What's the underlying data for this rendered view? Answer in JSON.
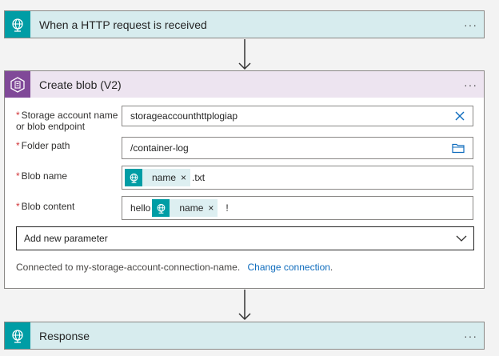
{
  "trigger": {
    "title": "When a HTTP request is received",
    "more": "···"
  },
  "action": {
    "title": "Create blob (V2)",
    "more": "···",
    "fields": {
      "storage_account": {
        "label_line1": "Storage account name",
        "label_line2": "or blob endpoint",
        "value": "storageaccounthttplogiap",
        "required": "*"
      },
      "folder_path": {
        "label": "Folder path",
        "value": "/container-log",
        "required": "*"
      },
      "blob_name": {
        "label": "Blob name",
        "token": "name",
        "suffix": ".txt",
        "required": "*"
      },
      "blob_content": {
        "label": "Blob content",
        "prefix": "hello",
        "token": "name",
        "suffix": "!",
        "required": "*"
      }
    },
    "add_parameter": "Add new parameter",
    "connection_text": "Connected to my-storage-account-connection-name.",
    "change_connection": "Change connection",
    "period": "."
  },
  "response": {
    "title": "Response",
    "more": "···"
  },
  "token_close": "×",
  "colors": {
    "http_teal": "#009da5",
    "blob_purple": "#804998",
    "link": "#0f6cbd"
  },
  "icons": [
    "http-globe-icon",
    "blob-storage-icon",
    "clear-icon",
    "folder-icon",
    "chevron-down-icon",
    "arrow-down-icon"
  ]
}
